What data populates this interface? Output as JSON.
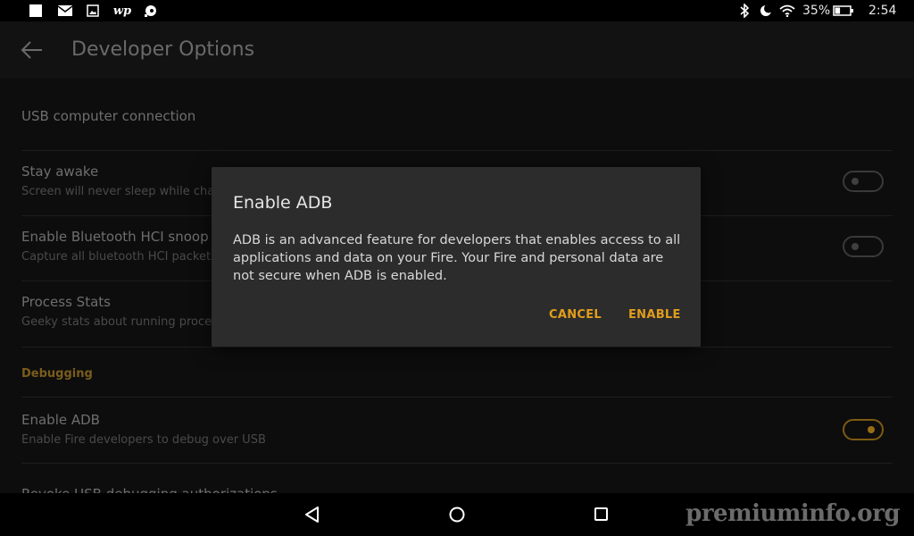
{
  "status_bar": {
    "notification_icons": [
      "square-notification-icon",
      "mail-icon",
      "image-icon",
      "washington-post-icon",
      "chat-icon"
    ],
    "battery_percent": "35%",
    "battery_level": 0.35,
    "time": "2:54",
    "indicators": [
      "bluetooth-icon",
      "do-not-disturb-moon-icon",
      "wifi-icon"
    ]
  },
  "app_bar": {
    "title": "Developer Options",
    "back_icon": "arrow-left-icon"
  },
  "settings": {
    "usb": {
      "title": "USB computer connection"
    },
    "stay_awake": {
      "title": "Stay awake",
      "subtitle": "Screen will never sleep while charging",
      "enabled": false
    },
    "bt_hci": {
      "title": "Enable Bluetooth HCI snoop log",
      "subtitle": "Capture all bluetooth HCI packets in a file",
      "enabled": false
    },
    "process_stats": {
      "title": "Process Stats",
      "subtitle": "Geeky stats about running processes"
    },
    "section_debugging": "Debugging",
    "enable_adb": {
      "title": "Enable ADB",
      "subtitle": "Enable Fire developers to debug over USB",
      "enabled": true
    },
    "revoke": {
      "title": "Revoke USB debugging authorizations"
    }
  },
  "dialog": {
    "title": "Enable ADB",
    "body": "ADB is an advanced feature for developers that enables access to all applications and data on your Fire. Your Fire and personal data are not secure when ADB is enabled.",
    "cancel_label": "CANCEL",
    "enable_label": "ENABLE"
  },
  "nav_bar": {
    "back": "back-triangle-icon",
    "home": "home-circle-icon",
    "recents": "recents-square-icon"
  },
  "watermark": "premiuminfo.org",
  "colors": {
    "accent": "#e29d1b",
    "background": "#0d0d0d",
    "dialog": "#2c2c2c"
  }
}
